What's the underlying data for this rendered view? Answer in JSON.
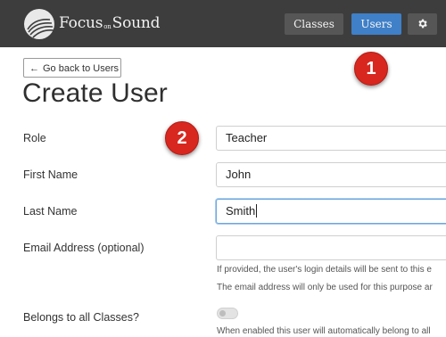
{
  "header": {
    "logo_main": "Focus",
    "logo_on": "on",
    "logo_sound": "Sound",
    "nav": {
      "classes_label": "Classes",
      "users_label": "Users",
      "settings_icon": "gear-icon"
    }
  },
  "annotations": {
    "badge1": "1",
    "badge2": "2",
    "color": "#d7271f"
  },
  "back_button_label": "Go back to Users",
  "page_title": "Create User",
  "form": {
    "role": {
      "label": "Role",
      "value": "Teacher"
    },
    "first_name": {
      "label": "First Name",
      "value": "John"
    },
    "last_name": {
      "label": "Last Name",
      "value": "Smith"
    },
    "email": {
      "label": "Email Address (optional)",
      "value": "",
      "help1": "If provided, the user's login details will be sent to this e",
      "help2": "The email address will only be used for this purpose ar"
    },
    "belongs_all": {
      "label": "Belongs to all Classes?",
      "enabled": false,
      "help": "When enabled this user will automatically belong to all"
    }
  },
  "colors": {
    "topbar": "#3d3d3d",
    "accent": "#3f80c8",
    "nav_button": "#565656"
  }
}
